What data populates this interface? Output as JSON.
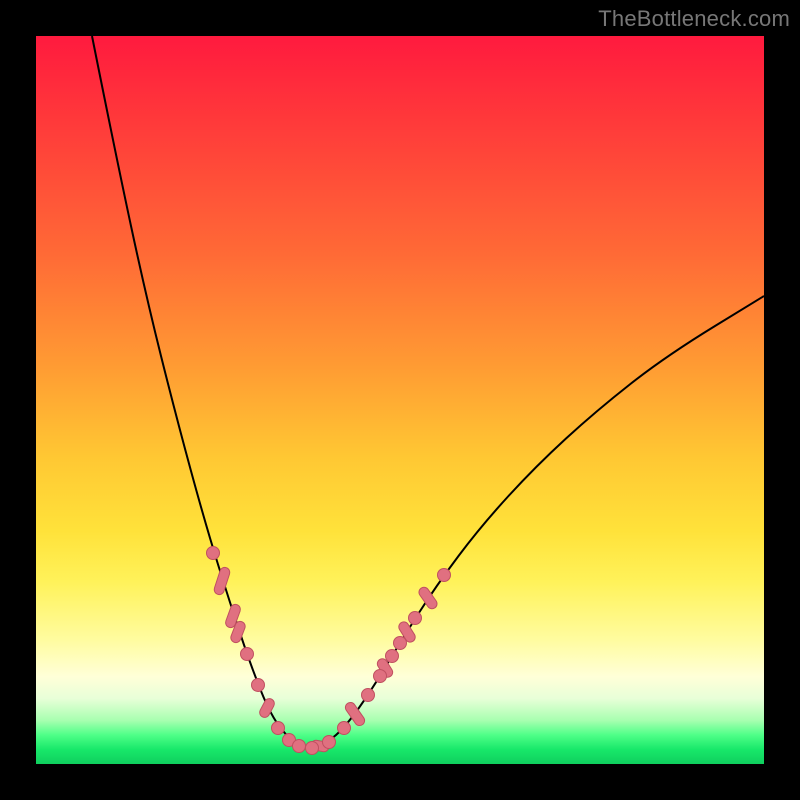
{
  "attribution": "TheBottleneck.com",
  "colors": {
    "dot": "#e07080",
    "dot_stroke": "#c05060",
    "curve": "#000000"
  },
  "chart_data": {
    "type": "line",
    "title": "",
    "xlabel": "",
    "ylabel": "",
    "xlim": [
      0,
      728
    ],
    "ylim": [
      0,
      728
    ],
    "note": "Bottleneck curve. Single V-shaped curve with a minimum near x≈270 at y≈712 (bottom of plot). Y-axis is inverted visually (higher pixel y = lower on screen). Pink dots/ticks mark points along both arms near the trough.",
    "series": [
      {
        "name": "bottleneck-curve",
        "points": [
          {
            "x": 56,
            "y": 0
          },
          {
            "x": 80,
            "y": 120
          },
          {
            "x": 110,
            "y": 260
          },
          {
            "x": 140,
            "y": 380
          },
          {
            "x": 170,
            "y": 490
          },
          {
            "x": 195,
            "y": 570
          },
          {
            "x": 215,
            "y": 630
          },
          {
            "x": 235,
            "y": 680
          },
          {
            "x": 255,
            "y": 705
          },
          {
            "x": 270,
            "y": 712
          },
          {
            "x": 290,
            "y": 708
          },
          {
            "x": 310,
            "y": 690
          },
          {
            "x": 335,
            "y": 655
          },
          {
            "x": 365,
            "y": 605
          },
          {
            "x": 400,
            "y": 550
          },
          {
            "x": 445,
            "y": 490
          },
          {
            "x": 500,
            "y": 430
          },
          {
            "x": 560,
            "y": 375
          },
          {
            "x": 630,
            "y": 320
          },
          {
            "x": 728,
            "y": 260
          }
        ]
      }
    ],
    "markers": {
      "dots": [
        {
          "x": 177,
          "y": 517
        },
        {
          "x": 211,
          "y": 618
        },
        {
          "x": 222,
          "y": 649
        },
        {
          "x": 242,
          "y": 692
        },
        {
          "x": 253,
          "y": 704
        },
        {
          "x": 263,
          "y": 710
        },
        {
          "x": 276,
          "y": 712
        },
        {
          "x": 293,
          "y": 706
        },
        {
          "x": 308,
          "y": 692
        },
        {
          "x": 332,
          "y": 659
        },
        {
          "x": 344,
          "y": 640
        },
        {
          "x": 356,
          "y": 620
        },
        {
          "x": 364,
          "y": 607
        },
        {
          "x": 379,
          "y": 582
        },
        {
          "x": 408,
          "y": 539
        }
      ],
      "ticks": [
        {
          "x": 186,
          "y": 545,
          "len": 28,
          "angle": -72
        },
        {
          "x": 197,
          "y": 580,
          "len": 24,
          "angle": -70
        },
        {
          "x": 202,
          "y": 596,
          "len": 22,
          "angle": -69
        },
        {
          "x": 231,
          "y": 672,
          "len": 20,
          "angle": -62
        },
        {
          "x": 284,
          "y": 710,
          "len": 18,
          "angle": 10
        },
        {
          "x": 319,
          "y": 678,
          "len": 26,
          "angle": 55
        },
        {
          "x": 349,
          "y": 632,
          "len": 20,
          "angle": 58
        },
        {
          "x": 371,
          "y": 596,
          "len": 22,
          "angle": 58
        },
        {
          "x": 392,
          "y": 562,
          "len": 24,
          "angle": 55
        }
      ]
    }
  }
}
